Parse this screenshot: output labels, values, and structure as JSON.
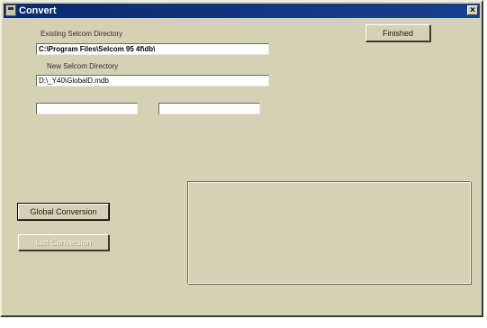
{
  "window": {
    "title": "Convert",
    "close_glyph": "×"
  },
  "existing_dir": {
    "label": "Existing Selcom Directory",
    "value": "C:\\Program Files\\Selcom 95 4f\\db\\"
  },
  "new_dir": {
    "label": "New Selcom Directory",
    "value": "D:\\_Y40\\GlobalD.mdb"
  },
  "extra_fields": {
    "left_value": "",
    "right_value": ""
  },
  "buttons": {
    "finished": "Finished",
    "global_conversion": "Global Conversion",
    "list_conversion": "List Conversion"
  },
  "colors": {
    "face": "#d5d1b5",
    "titlebar": "#0a2a6e"
  }
}
